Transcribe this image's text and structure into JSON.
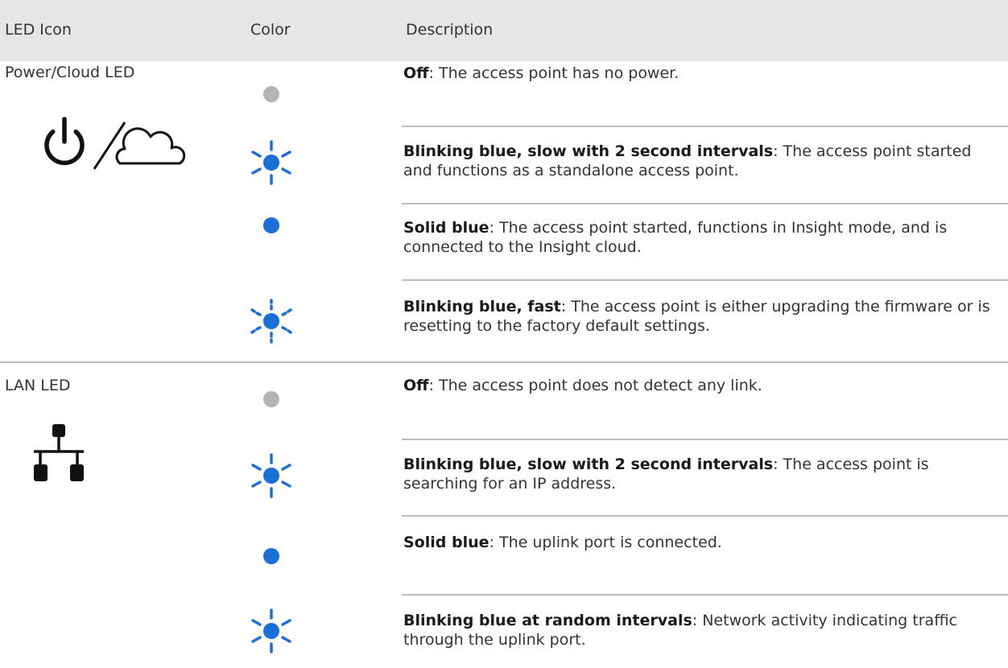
{
  "header": {
    "col_icon": "LED Icon",
    "col_color": "Color",
    "col_description": "Description"
  },
  "colors": {
    "header_bg": "#e6e6e6",
    "led_off": "#b4b4b4",
    "led_blue": "#1c6fd6",
    "divider": "#bdbdbd"
  },
  "groups": [
    {
      "label": "Power/Cloud LED",
      "icon": "power-cloud-icon",
      "rows": [
        {
          "color_state": "off-gray-dot",
          "title": "Off",
          "text": ": The access point has no power."
        },
        {
          "color_state": "blinking-blue-icon",
          "title": "Blinking blue, slow with 2 second intervals",
          "text": ": The access point started and functions as a standalone access point."
        },
        {
          "color_state": "solid-blue-dot",
          "title": "Solid blue",
          "text": ": The access point started, functions in Insight mode, and is connected to the Insight cloud."
        },
        {
          "color_state": "blinking-blue-fast-icon",
          "title": "Blinking blue, fast",
          "text": ": The access point is either upgrading the firmware or is resetting to the factory default settings."
        }
      ]
    },
    {
      "label": "LAN LED",
      "icon": "lan-network-icon",
      "rows": [
        {
          "color_state": "off-gray-dot",
          "title": "Off",
          "text": ": The access point does not detect any link."
        },
        {
          "color_state": "blinking-blue-icon",
          "title": "Blinking blue, slow with 2 second intervals",
          "text": ": The access point is searching for an IP address."
        },
        {
          "color_state": "solid-blue-dot",
          "title": "Solid blue",
          "text": ": The uplink port is connected."
        },
        {
          "color_state": "blinking-blue-icon",
          "title": "Blinking blue at random intervals",
          "text": ": Network activity indicating traffic through the uplink port."
        }
      ]
    }
  ]
}
